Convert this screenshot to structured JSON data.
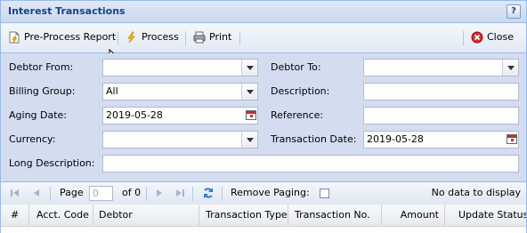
{
  "panel": {
    "title": "Interest Transactions",
    "help_label": "?"
  },
  "toolbar": {
    "preprocess_label": "Pre-Process Report",
    "process_label": "Process",
    "print_label": "Print",
    "close_label": "Close"
  },
  "form": {
    "debtor_from_label": "Debtor From:",
    "debtor_from_value": "",
    "debtor_to_label": "Debtor To:",
    "debtor_to_value": "",
    "billing_group_label": "Billing Group:",
    "billing_group_value": "All",
    "description_label": "Description:",
    "description_value": "",
    "aging_date_label": "Aging Date:",
    "aging_date_value": "2019-05-28",
    "reference_label": "Reference:",
    "reference_value": "",
    "currency_label": "Currency:",
    "currency_value": "",
    "transaction_date_label": "Transaction Date:",
    "transaction_date_value": "2019-05-28",
    "long_description_label": "Long Description:",
    "long_description_value": ""
  },
  "pager": {
    "page_label": "Page",
    "page_value": "0",
    "of_label": "of 0",
    "remove_paging_label": "Remove Paging:",
    "status": "No data to display"
  },
  "grid": {
    "columns": [
      "#",
      "Acct. Code",
      "Debtor",
      "Transaction Type",
      "Transaction No.",
      "Amount",
      "Update Status"
    ]
  },
  "colors": {
    "title": "#15428b",
    "panel_bg": "#d4ddf0",
    "border": "#99bbe8"
  }
}
